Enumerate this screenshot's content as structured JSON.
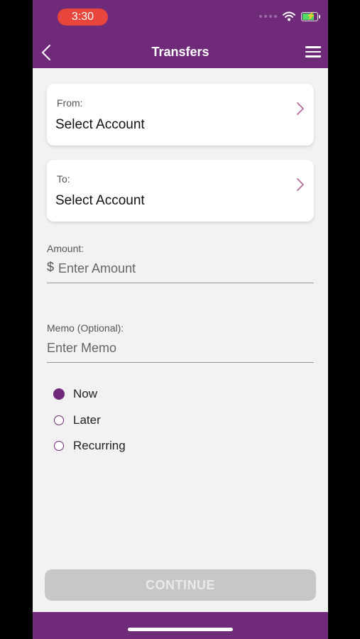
{
  "status_bar": {
    "time": "3:30"
  },
  "nav": {
    "title": "Transfers"
  },
  "from_card": {
    "label": "From:",
    "value": "Select Account"
  },
  "to_card": {
    "label": "To:",
    "value": "Select Account"
  },
  "amount": {
    "label": "Amount:",
    "prefix": "$",
    "placeholder": "Enter Amount"
  },
  "memo": {
    "label": "Memo (Optional):",
    "placeholder": "Enter Memo"
  },
  "schedule": {
    "options": [
      {
        "label": "Now",
        "selected": true
      },
      {
        "label": "Later",
        "selected": false
      },
      {
        "label": "Recurring",
        "selected": false
      }
    ]
  },
  "continue_label": "CONTINUE",
  "colors": {
    "brand": "#6f2a7a",
    "time_pill": "#e8453c",
    "button_disabled": "#c7c7c7"
  }
}
